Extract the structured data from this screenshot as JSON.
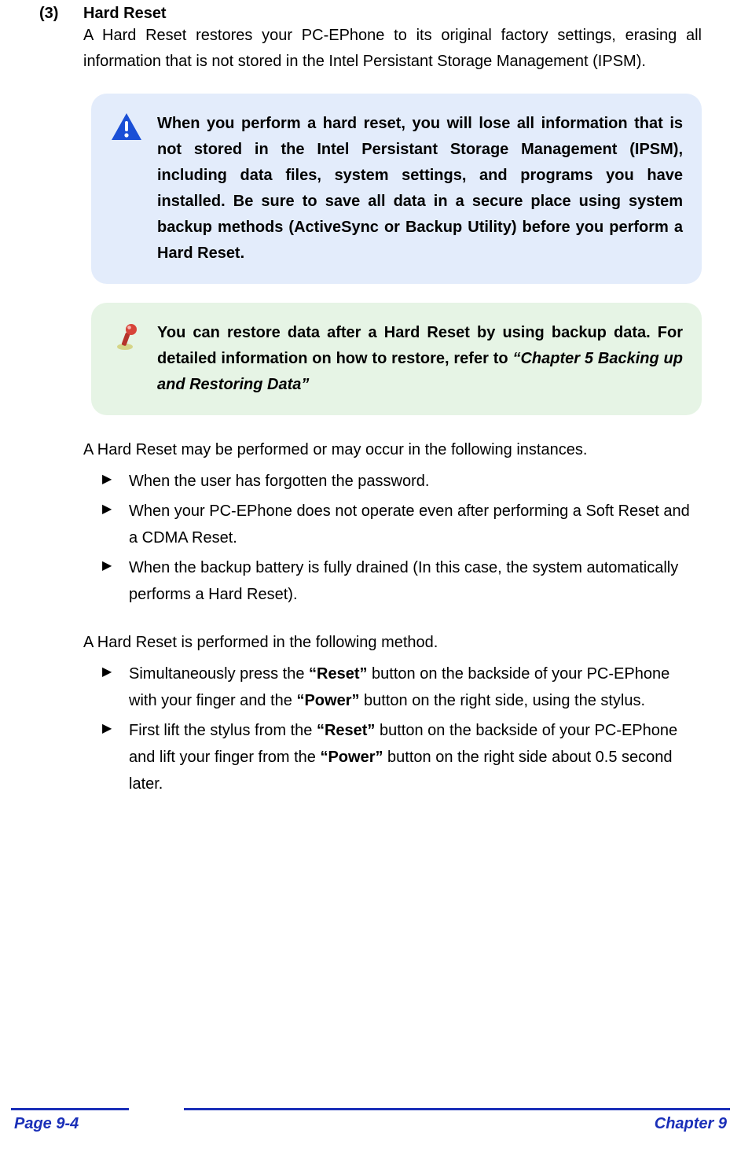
{
  "section": {
    "num": "(3)",
    "title": "Hard Reset"
  },
  "intro": "A Hard Reset restores your PC-EPhone to its original factory settings, erasing all information that is not stored in the Intel Persistant Storage Management (IPSM).",
  "warn": "When you perform a hard reset, you will lose all information that is not stored in the Intel Persistant Storage Management (IPSM), including data files, system settings, and programs you have installed. Be sure to save all data in a secure place using system backup methods (ActiveSync or Backup Utility) before you perform a Hard Reset.",
  "tip_lead": "You can restore data after a Hard Reset by using backup data. For detailed information on how to restore, refer to ",
  "tip_ref": "“Chapter 5 Backing up and Restoring Data”",
  "instances_lead": "A Hard Reset may be performed or may occur in the following instances.",
  "instances": [
    "When the user has forgotten the password.",
    "When your PC-EPhone does not operate even after performing a Soft Reset and a CDMA Reset.",
    "When the backup battery is fully drained (In this case, the system automatically performs a Hard Reset)."
  ],
  "method_lead": "A Hard Reset is performed in the following method.",
  "method": [
    {
      "pre": "Simultaneously press the ",
      "b1": "“Reset”",
      "mid": " button on the backside of your PC-EPhone with your finger and the ",
      "b2": "“Power”",
      "post": " button on the right side, using the stylus."
    },
    {
      "pre": "First lift the stylus from the ",
      "b1": "“Reset”",
      "mid": " button on the backside of your PC-EPhone and lift your finger from the ",
      "b2": "“Power”",
      "post": " button on the right side about 0.5 second later."
    }
  ],
  "footer": {
    "left": "Page 9-4",
    "right": "Chapter 9"
  }
}
